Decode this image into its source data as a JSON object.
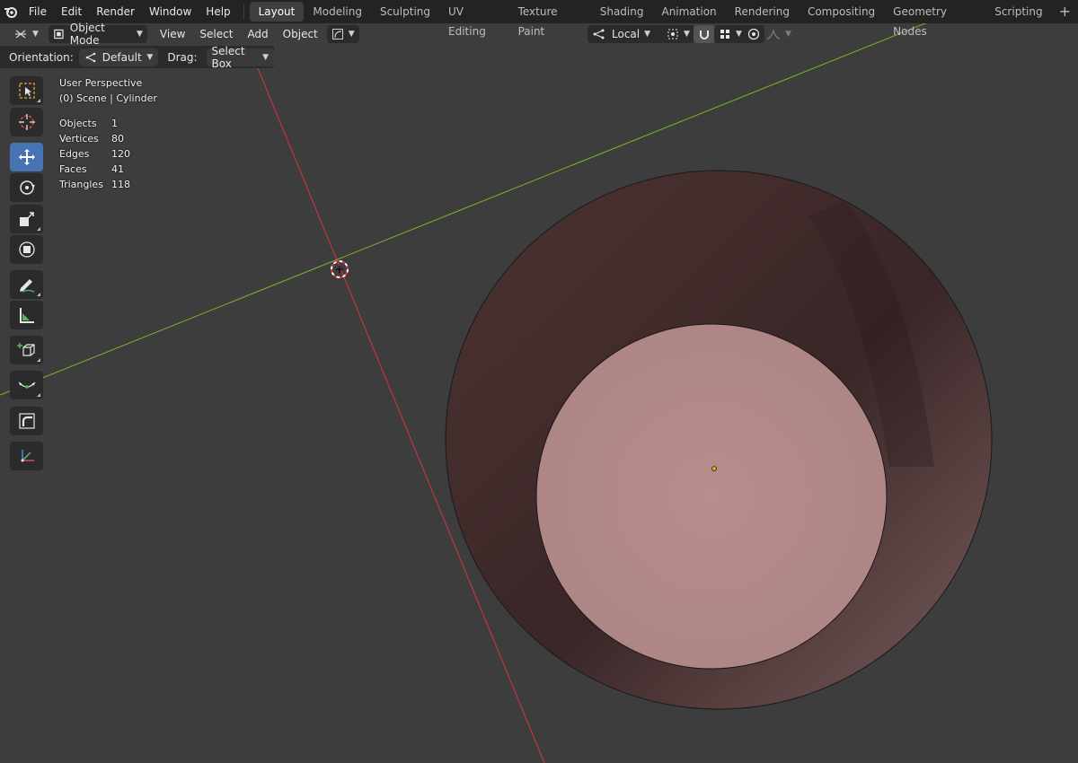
{
  "menubar": {
    "items": [
      "File",
      "Edit",
      "Render",
      "Window",
      "Help"
    ],
    "workspaces": [
      "Layout",
      "Modeling",
      "Sculpting",
      "UV Editing",
      "Texture Paint",
      "Shading",
      "Animation",
      "Rendering",
      "Compositing",
      "Geometry Nodes",
      "Scripting"
    ],
    "active_workspace": "Layout",
    "add_tab": "+"
  },
  "header": {
    "mode": "Object Mode",
    "menus": [
      "View",
      "Select",
      "Add",
      "Object"
    ],
    "transform_orientation": "Local"
  },
  "tool_settings": {
    "orientation_label": "Orientation:",
    "orientation_value": "Default",
    "drag_label": "Drag:",
    "drag_value": "Select Box"
  },
  "toolbar": {
    "tools": [
      "select-box",
      "cursor",
      "move",
      "rotate",
      "scale",
      "transform",
      "annotate",
      "measure",
      "add-cube",
      "shear",
      "bend",
      "transform-axes"
    ],
    "active_tool": "move"
  },
  "viewport": {
    "view_name": "User Perspective",
    "scene_info": "(0) Scene | Cylinder",
    "stats": [
      {
        "label": "Objects",
        "value": "1"
      },
      {
        "label": "Vertices",
        "value": "80"
      },
      {
        "label": "Edges",
        "value": "120"
      },
      {
        "label": "Faces",
        "value": "41"
      },
      {
        "label": "Triangles",
        "value": "118"
      }
    ]
  },
  "colors": {
    "background": "#3d3d3d",
    "menubar": "#232323",
    "active_tool": "#4772b3",
    "x_axis": "#d9323f",
    "y_axis": "#7ab52e",
    "cylinder_top": "#b08684",
    "cylinder_inner": "#4a3030"
  }
}
